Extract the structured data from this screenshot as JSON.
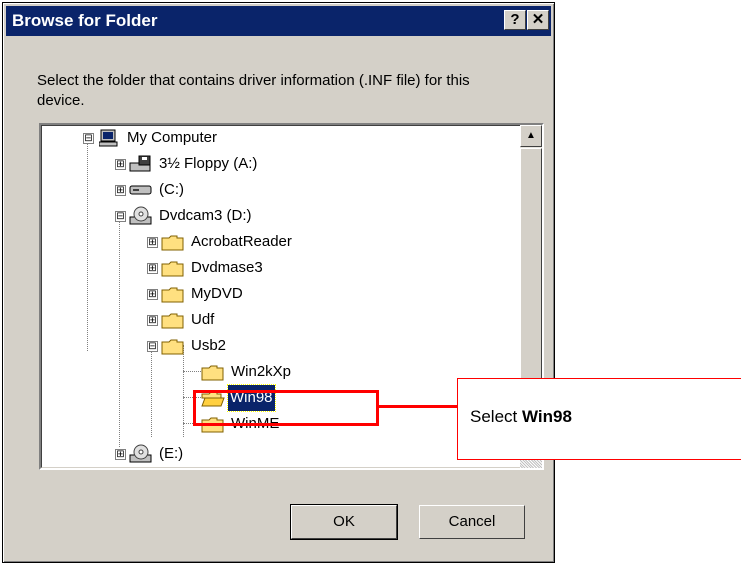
{
  "window": {
    "title": "Browse for Folder",
    "help_label": "?",
    "close_label": "✕"
  },
  "instruction": "Select the folder that contains driver information (.INF file) for this device.",
  "tree": {
    "items": [
      {
        "label": "My Computer",
        "expand": "⊟",
        "icon": "computer-icon"
      },
      {
        "label": "3½ Floppy (A:)",
        "expand": "⊞",
        "icon": "floppy-icon"
      },
      {
        "label": "(C:)",
        "expand": "⊞",
        "icon": "hard-drive-icon"
      },
      {
        "label": "Dvdcam3 (D:)",
        "expand": "⊟",
        "icon": "cd-drive-icon"
      },
      {
        "label": "AcrobatReader",
        "expand": "⊞",
        "icon": "folder-icon"
      },
      {
        "label": "Dvdmase3",
        "expand": "⊞",
        "icon": "folder-icon"
      },
      {
        "label": "MyDVD",
        "expand": "⊞",
        "icon": "folder-icon"
      },
      {
        "label": "Udf",
        "expand": "⊞",
        "icon": "folder-icon"
      },
      {
        "label": "Usb2",
        "expand": "⊟",
        "icon": "folder-icon"
      },
      {
        "label": "Win2kXp",
        "expand": "",
        "icon": "folder-icon"
      },
      {
        "label": "Win98",
        "expand": "",
        "icon": "folder-open-icon",
        "selected": true
      },
      {
        "label": "WinME",
        "expand": "",
        "icon": "folder-icon"
      },
      {
        "label": "(E:)",
        "expand": "⊞",
        "icon": "cd-drive-icon"
      }
    ]
  },
  "buttons": {
    "ok": "OK",
    "cancel": "Cancel"
  },
  "callout": {
    "prefix": "Select ",
    "bold": "Win98"
  },
  "colors": {
    "titlebar": "#0a246a",
    "selection": "#0a246a",
    "annotation": "#ff0000",
    "dialog_face": "#d4d0c8"
  }
}
